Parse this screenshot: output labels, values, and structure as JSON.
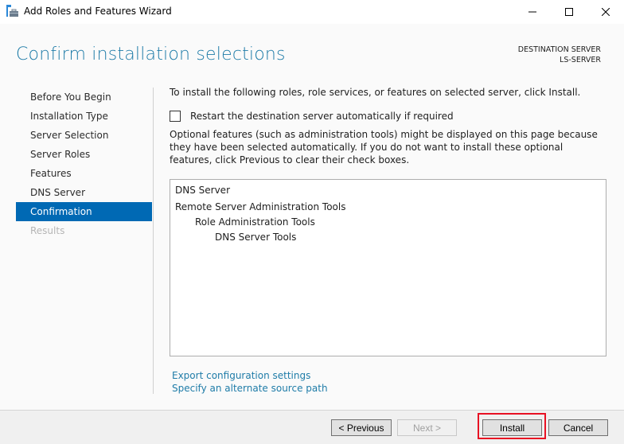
{
  "window": {
    "title": "Add Roles and Features Wizard",
    "icon": "server-manager-icon",
    "controls": [
      "minimize-icon",
      "maximize-icon",
      "close-icon"
    ]
  },
  "header": {
    "page_title": "Confirm installation selections",
    "destination_label": "DESTINATION SERVER",
    "destination_server": "LS-SERVER"
  },
  "nav": {
    "items": [
      {
        "label": "Before You Begin",
        "state": "normal"
      },
      {
        "label": "Installation Type",
        "state": "normal"
      },
      {
        "label": "Server Selection",
        "state": "normal"
      },
      {
        "label": "Server Roles",
        "state": "normal"
      },
      {
        "label": "Features",
        "state": "normal"
      },
      {
        "label": "DNS Server",
        "state": "normal"
      },
      {
        "label": "Confirmation",
        "state": "active"
      },
      {
        "label": "Results",
        "state": "disabled"
      }
    ]
  },
  "main": {
    "intro": "To install the following roles, role services, or features on selected server, click Install.",
    "restart_label": "Restart the destination server automatically if required",
    "restart_checked": false,
    "optional_text": "Optional features (such as administration tools) might be displayed on this page because they have been selected automatically. If you do not want to install these optional features, click Previous to clear their check boxes.",
    "selections": [
      {
        "label": "DNS Server",
        "level": 0
      },
      {
        "label": "Remote Server Administration Tools",
        "level": 0
      },
      {
        "label": "Role Administration Tools",
        "level": 1
      },
      {
        "label": "DNS Server Tools",
        "level": 2
      }
    ],
    "links": {
      "export": "Export configuration settings",
      "alternate_source": "Specify an alternate source path"
    }
  },
  "footer": {
    "previous": "< Previous",
    "next": "Next >",
    "install": "Install",
    "cancel": "Cancel"
  },
  "colors": {
    "accent": "#0069b4",
    "title": "#1f7ca8",
    "highlight": "#e81123"
  }
}
